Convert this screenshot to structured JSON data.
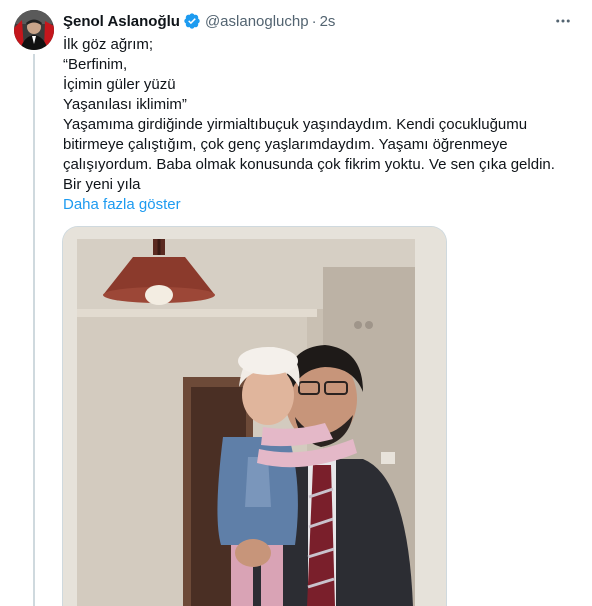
{
  "tweet": {
    "author": {
      "display_name": "Şenol Aslanoğlu",
      "handle": "@aslanogluchp",
      "verified": true
    },
    "separator": "·",
    "timestamp": "2s",
    "text_lines": [
      "İlk göz ağrım;",
      "“Berfinim,",
      "İçimin güler yüzü",
      "Yaşanılası iklimim”",
      "Yaşamıma girdiğinde yirmialtıbuçuk yaşındaydım. Kendi çocukluğumu",
      "bitirmeye çalıştığım, çok genç yaşlarımdaydım. Yaşamı öğrenmeye",
      "çalışıyordum. Baba olmak konusunda çok fikrim yoktu. Ve sen çıka geldin.",
      "Bir yeni yıla"
    ],
    "show_more_label": "Daha fazla göster",
    "more_icon": "ellipsis-icon",
    "media_icon": "photo"
  },
  "colors": {
    "link": "#1d9bf0",
    "verified": "#1d9bf0",
    "secondary_text": "#536471",
    "primary_text": "#0f1419",
    "divider": "#cfd9de"
  }
}
